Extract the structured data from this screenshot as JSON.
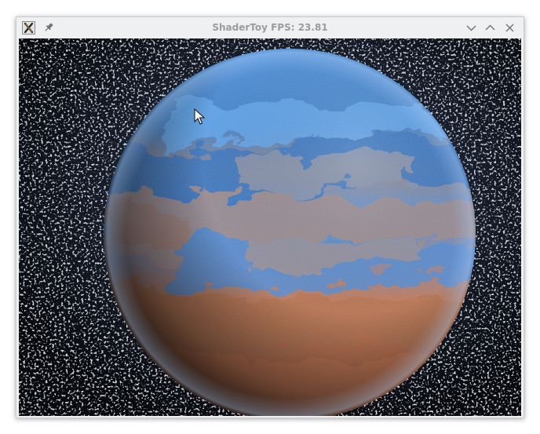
{
  "window": {
    "title": "ShaderToy FPS: 23.81",
    "app_icon": "app-x-icon",
    "controls": [
      "pin-icon",
      "minimize-icon",
      "maximize-icon",
      "close-icon"
    ]
  },
  "viewport": {
    "content": "rendered-planet-shader"
  },
  "colors": {
    "titlebar_bg": "#eff0f1",
    "title_text": "#9a9c9e",
    "ocean_blue": "#3f86cf",
    "land_orange": "#b8643a",
    "space_bg": "#0b0c0f"
  }
}
